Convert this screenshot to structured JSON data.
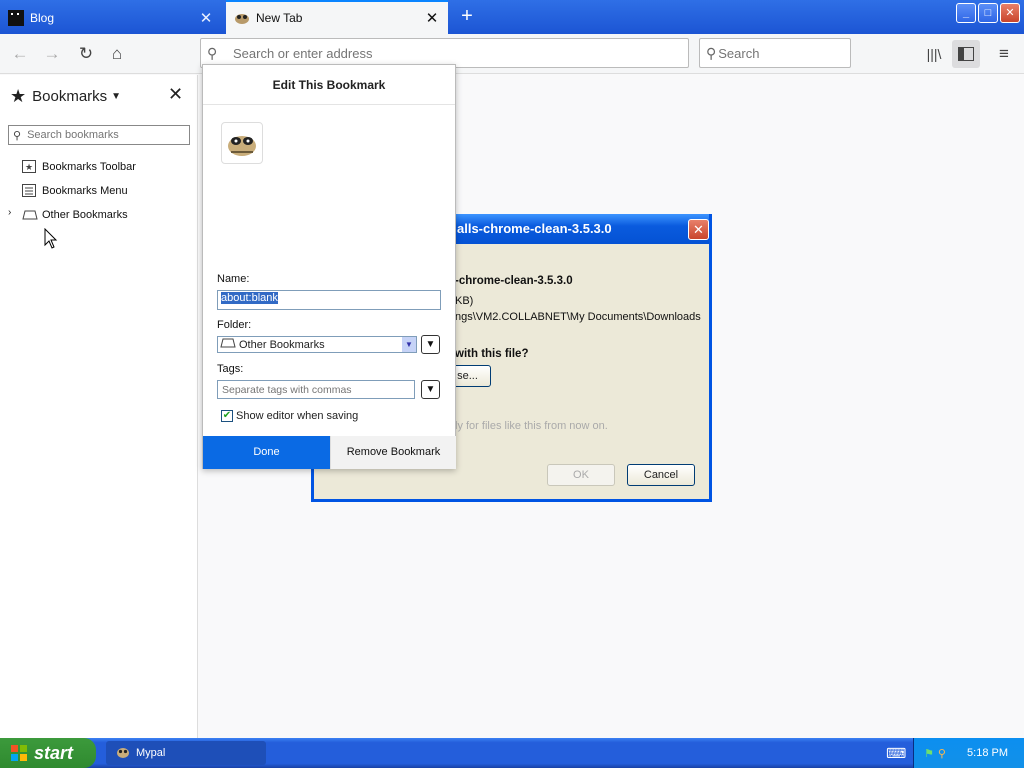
{
  "tabs": [
    {
      "title": "Blog",
      "active": false
    },
    {
      "title": "New Tab",
      "active": true
    }
  ],
  "window_controls": {
    "minimize": "_",
    "maximize": "□",
    "close": "✕"
  },
  "navbar": {
    "url_placeholder": "Search or enter address",
    "search_placeholder": "Search"
  },
  "icons": {
    "back": "arrow-left-icon",
    "forward": "arrow-right-icon",
    "reload": "reload-icon",
    "home": "home-icon",
    "library": "library-icon",
    "sidebar": "sidebar-icon",
    "menu": "hamburger-menu-icon"
  },
  "sidebar": {
    "title": "Bookmarks",
    "search_placeholder": "Search bookmarks",
    "items": [
      {
        "label": "Bookmarks Toolbar",
        "icon": "bookmarks-toolbar-icon"
      },
      {
        "label": "Bookmarks Menu",
        "icon": "bookmarks-menu-icon"
      },
      {
        "label": "Other Bookmarks",
        "icon": "other-bookmarks-icon"
      }
    ]
  },
  "download_dialog": {
    "title": "alls-chrome-clean-3.5.3.0",
    "filename": "-chrome-clean-3.5.3.0",
    "size": "KB)",
    "path": "ngs\\VM2.COLLABNET\\My Documents\\Downloads",
    "question": "with this file?",
    "browse_label": "se...",
    "auto_text": "ly for files like this from now on.",
    "ok_label": "OK",
    "cancel_label": "Cancel"
  },
  "edit_bookmark": {
    "header": "Edit This Bookmark",
    "name_label": "Name:",
    "name_value": "about:blank",
    "folder_label": "Folder:",
    "folder_value": "Other Bookmarks",
    "tags_label": "Tags:",
    "tags_placeholder": "Separate tags with commas",
    "show_editor_label": "Show editor when saving",
    "show_editor_checked": true,
    "done_label": "Done",
    "remove_label": "Remove Bookmark"
  },
  "taskbar": {
    "start_label": "start",
    "tasks": [
      {
        "label": "Mypal"
      }
    ],
    "clock": "5:18 PM"
  },
  "colors": {
    "titlebar_blue": "#1c55d4",
    "done_button": "#0a6ae4",
    "xp_start_green": "#3c9a3c",
    "selection_blue": "#316ac5"
  }
}
